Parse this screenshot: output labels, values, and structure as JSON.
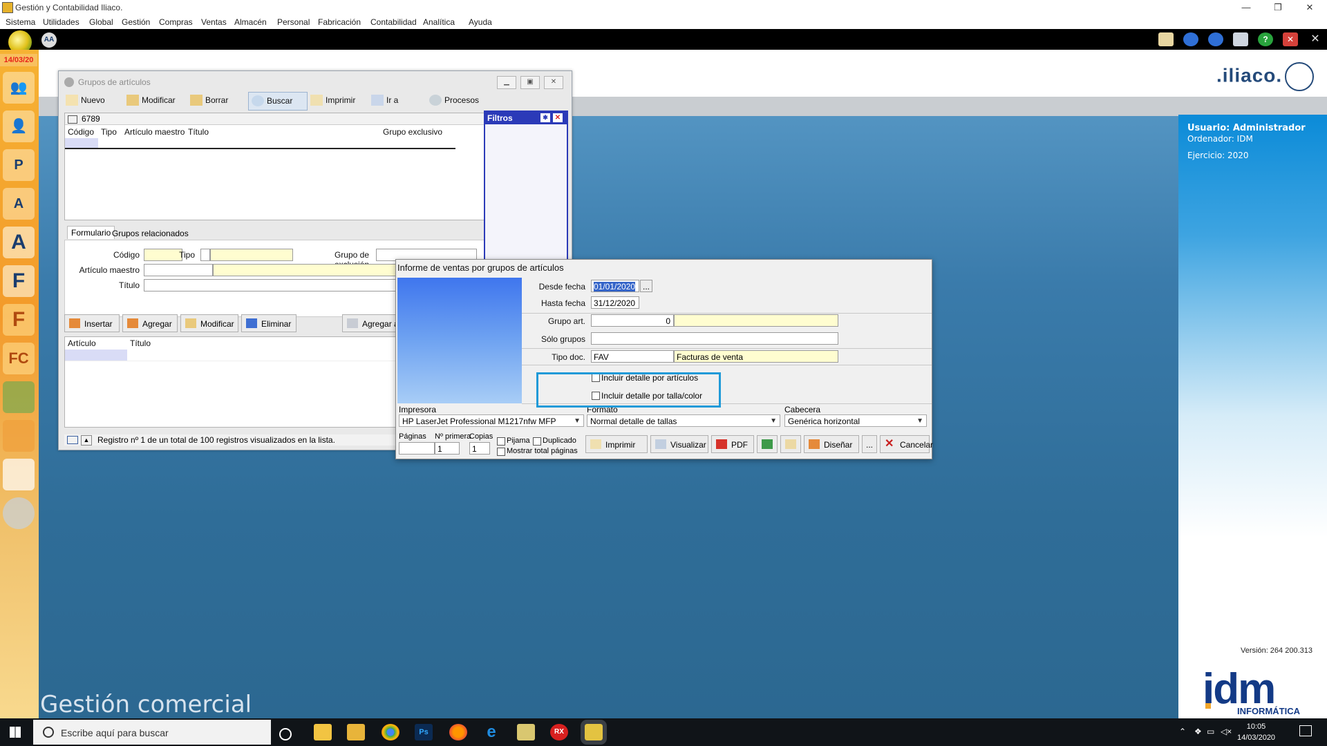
{
  "window": {
    "title": "Gestión y Contabilidad Iliaco.",
    "menu": [
      "Sistema",
      "Utilidades",
      "Global",
      "Gestión",
      "Compras",
      "Ventas",
      "Almacén",
      "Personal",
      "Fabricación",
      "Contabilidad",
      "Analítica",
      "Ayuda"
    ]
  },
  "sidebar": {
    "date": "14/03/20"
  },
  "brand": {
    "logo": ".iliaco.",
    "footer_title": "Gestión comercial"
  },
  "user_panel": {
    "usuario": "Usuario: Administrador",
    "ordenador": "Ordenador: IDM",
    "ejercicio": "Ejercicio: 2020",
    "version": "Versión: 264 200.313",
    "company_logo": "idm",
    "company_sub": "INFORMÁTICA"
  },
  "grupos_window": {
    "title": "Grupos de artículos",
    "toolbar": [
      "Nuevo",
      "Modificar",
      "Borrar",
      "Buscar",
      "Imprimir",
      "Ir a",
      "Procesos"
    ],
    "record_count": "6789",
    "columns": [
      "Código",
      "Tipo",
      "Artículo maestro",
      "Título",
      "Grupo exclusivo"
    ],
    "tabs": [
      "Formulario",
      "Grupos relacionados"
    ],
    "fields": {
      "codigo_label": "Código",
      "tipo_label": "Tipo",
      "grupo_exclusion_label": "Grupo de exclusión",
      "articulo_maestro_label": "Artículo maestro",
      "titulo_label": "Título"
    },
    "sub_toolbar": [
      "Insertar",
      "Agregar",
      "Modificar",
      "Eliminar",
      "Agregar a"
    ],
    "sub_columns": [
      "Artículo",
      "Título"
    ],
    "status": "Registro nº 1 de un total de 100 registros visualizados en la lista.",
    "filtros": "Filtros"
  },
  "informe_dialog": {
    "title": "Informe de ventas por grupos de artículos",
    "desde_fecha_label": "Desde fecha",
    "desde_fecha": "01/01/2020",
    "hasta_fecha_label": "Hasta fecha",
    "hasta_fecha": "31/12/2020",
    "ellipsis": "...",
    "grupo_art_label": "Grupo art.",
    "grupo_art_value": "0",
    "solo_grupos_label": "Sólo grupos",
    "tipo_doc_label": "Tipo doc.",
    "tipo_doc_code": "FAV",
    "tipo_doc_desc": "Facturas de venta",
    "chk_articulos": "Incluir detalle por artículos",
    "chk_talla": "Incluir detalle por talla/color",
    "impresora_label": "Impresora",
    "impresora_value": "HP LaserJet Professional M1217nfw MFP",
    "formato_label": "Formato",
    "formato_value": "Normal detalle de tallas",
    "cabecera_label": "Cabecera",
    "cabecera_value": "Genérica horizontal",
    "paginas_label": "Páginas",
    "nprimera_label": "Nº primera",
    "nprimera_value": "1",
    "copias_label": "Copias",
    "copias_value": "1",
    "pijama": "Pijama",
    "duplicado": "Duplicado",
    "mostrar_total": "Mostrar total páginas",
    "buttons": {
      "imprimir": "Imprimir",
      "visualizar": "Visualizar",
      "pdf": "PDF",
      "disenar": "Diseñar",
      "more": "...",
      "cancelar": "Cancelar"
    }
  },
  "taskbar": {
    "search_placeholder": "Escribe aquí para buscar",
    "time": "10:05",
    "date": "14/03/2020"
  }
}
